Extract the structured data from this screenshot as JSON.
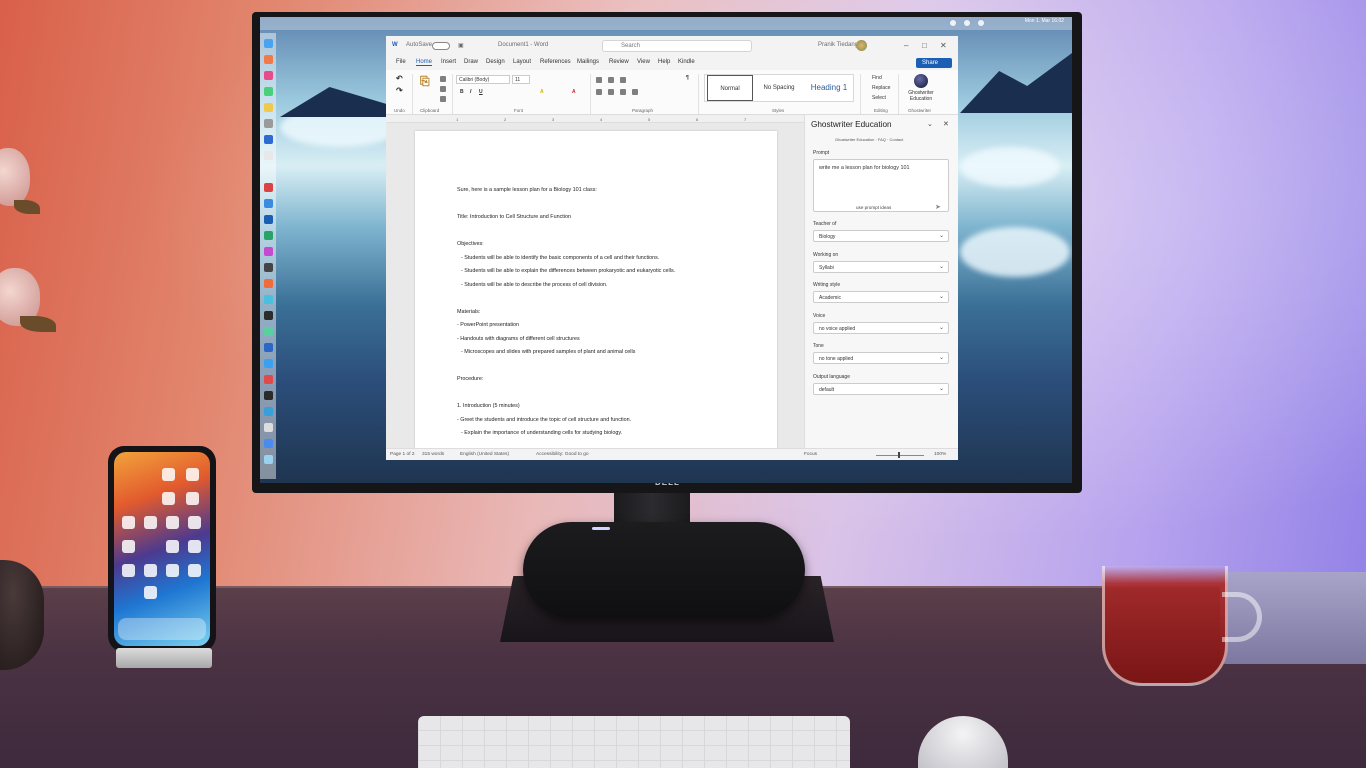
{
  "word": {
    "titlebar": {
      "autosave": "AutoSave",
      "doc_title": "Document1 - Word",
      "search_placeholder": "Search",
      "user": "Pranik Tiedang"
    },
    "tabs": [
      "File",
      "Home",
      "Insert",
      "Draw",
      "Design",
      "Layout",
      "References",
      "Mailings",
      "Review",
      "View",
      "Help",
      "Kindle"
    ],
    "share": "Share",
    "ribbon": {
      "font_name": "Calibri (Body)",
      "font_size": "11",
      "styles": [
        "Normal",
        "No Spacing",
        "Heading 1"
      ],
      "group_labels": [
        "Undo",
        "Clipboard",
        "Font",
        "Paragraph",
        "Styles",
        "Editing",
        "Ghostwriter"
      ],
      "editing": [
        "Find",
        "Replace",
        "Select"
      ],
      "addin": "Ghostwriter Education"
    },
    "document_lines": [
      "Sure, here is a sample lesson plan for a Biology 101 class:",
      "",
      "Title: Introduction to Cell Structure and Function",
      "",
      "Objectives:",
      "- Students will be able to identify the basic components of a cell and their functions.",
      "- Students will be able to explain the differences between prokaryotic and eukaryotic cells.",
      "- Students will be able to describe the process of cell division.",
      "",
      "Materials:",
      "- PowerPoint presentation",
      "- Handouts with diagrams of different cell structures",
      "- Microscopes and slides with prepared samples of plant and animal cells",
      "",
      "Procedure:",
      "",
      "1. Introduction (5 minutes)",
      "- Greet the students and introduce the topic of cell structure and function.",
      "- Explain the importance of understanding cells for studying biology."
    ],
    "status": {
      "page": "Page 1 of 2",
      "words": "315 words",
      "language": "English (United States)",
      "accessibility": "Accessibility: Good to go",
      "focus": "Focus",
      "zoom": "100%"
    }
  },
  "ghostwriter": {
    "title": "Ghostwriter Education",
    "subtitle": "Ghostwriter Education · FAQ · Contact",
    "prompt_label": "Prompt",
    "prompt_value": "write me a lesson plan for biology 101",
    "prompt_hint": "use prompt ideas",
    "fields": [
      {
        "label": "Teacher of",
        "value": "Biology"
      },
      {
        "label": "Working on",
        "value": "Syllabi"
      },
      {
        "label": "Writing style",
        "value": "Academic"
      },
      {
        "label": "Voice",
        "value": "no voice applied"
      },
      {
        "label": "Tone",
        "value": "no tone applied"
      },
      {
        "label": "Output language",
        "value": "default"
      }
    ]
  },
  "monitor": {
    "brand": "DELL"
  },
  "menubar": {
    "clock": "Mon 1. Mar 16:02"
  }
}
